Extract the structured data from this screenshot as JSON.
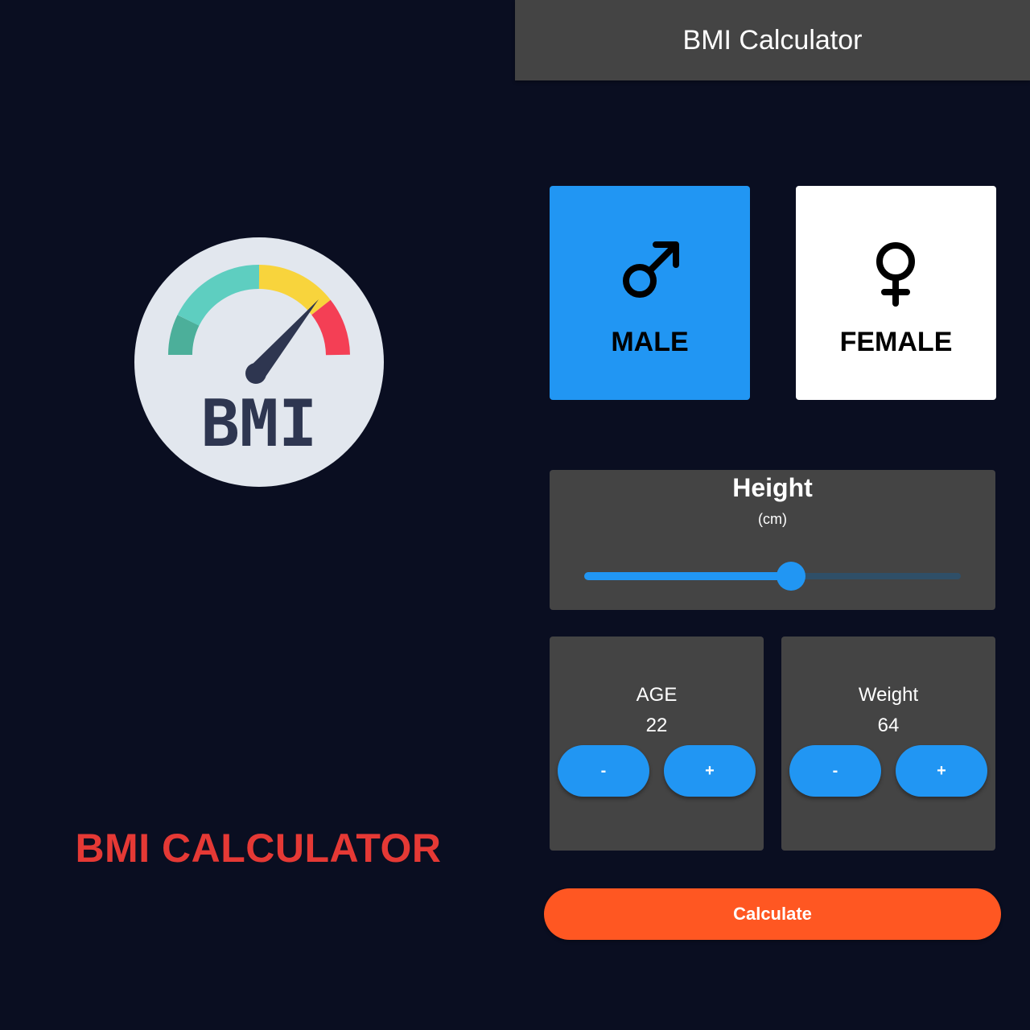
{
  "splash": {
    "logo_text": "BMI",
    "title": "BMI CALCULATOR",
    "title_color": "#e53935",
    "logo_colors": {
      "face": "#e2e7ee",
      "gauge_green_dark": "#4caf9a",
      "gauge_teal": "#5ecec0",
      "gauge_yellow": "#f8d43c",
      "gauge_red": "#f43f55",
      "needle": "#2e3650"
    }
  },
  "appbar": {
    "title": "BMI Calculator"
  },
  "gender": {
    "selected": "male",
    "male": {
      "label": "MALE",
      "icon": "male-symbol-icon",
      "bg": "#2196f3"
    },
    "female": {
      "label": "FEMALE",
      "icon": "female-symbol-icon",
      "bg": "#ffffff"
    }
  },
  "height": {
    "label": "Height",
    "unit": "(cm)",
    "slider_fraction": 0.55
  },
  "age": {
    "label": "AGE",
    "value": "22",
    "minus": "-",
    "plus": "+"
  },
  "weight": {
    "label": "Weight",
    "value": "64",
    "minus": "-",
    "plus": "+"
  },
  "calculate": {
    "label": "Calculate",
    "color": "#ff5722"
  },
  "colors": {
    "background": "#0a0e21",
    "card": "#444444",
    "accent": "#2196f3"
  }
}
